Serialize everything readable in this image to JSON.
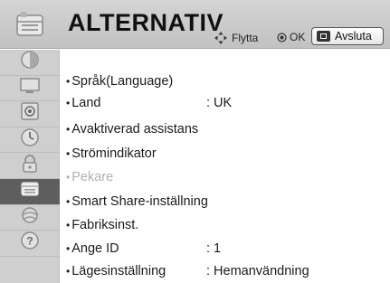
{
  "header": {
    "title": "ALTERNATIV",
    "icon": "options-menu-icon",
    "move_hint": "Flytta",
    "move_icon": "dpad-arrows-icon",
    "ok_hint": "OK",
    "ok_icon": "ok-button-icon",
    "exit_label": "Avsluta",
    "exit_icon": "exit-key-icon"
  },
  "sidebar": {
    "items": [
      {
        "name": "picture-icon",
        "active": false
      },
      {
        "name": "screen-icon",
        "active": false
      },
      {
        "name": "audio-icon",
        "active": false
      },
      {
        "name": "clock-icon",
        "active": false
      },
      {
        "name": "lock-icon",
        "active": false
      },
      {
        "name": "options-icon",
        "active": true
      },
      {
        "name": "network-icon",
        "active": false
      },
      {
        "name": "help-icon",
        "active": false
      }
    ]
  },
  "menu": {
    "items": [
      {
        "label": "Språk(Language)",
        "value": "",
        "disabled": false
      },
      {
        "label": "Land",
        "value": ": UK",
        "disabled": false
      },
      {
        "label": "Avaktiverad assistans",
        "value": "",
        "disabled": false
      },
      {
        "label": "Strömindikator",
        "value": "",
        "disabled": false
      },
      {
        "label": "Pekare",
        "value": "",
        "disabled": true
      },
      {
        "label": "Smart Share-inställning",
        "value": "",
        "disabled": false
      },
      {
        "label": "Fabriksinst.",
        "value": "",
        "disabled": false
      },
      {
        "label": "Ange ID",
        "value": ": 1",
        "disabled": false
      },
      {
        "label": "Lägesinställning",
        "value": ": Hemanvändning",
        "disabled": false
      }
    ]
  },
  "colors": {
    "header_bg": "#c8c8c8",
    "sidebar_bg": "#cfcfcf",
    "sidebar_active": "#5e5e5e",
    "text": "#1a1a1a",
    "disabled_text": "#b0b0b0"
  }
}
